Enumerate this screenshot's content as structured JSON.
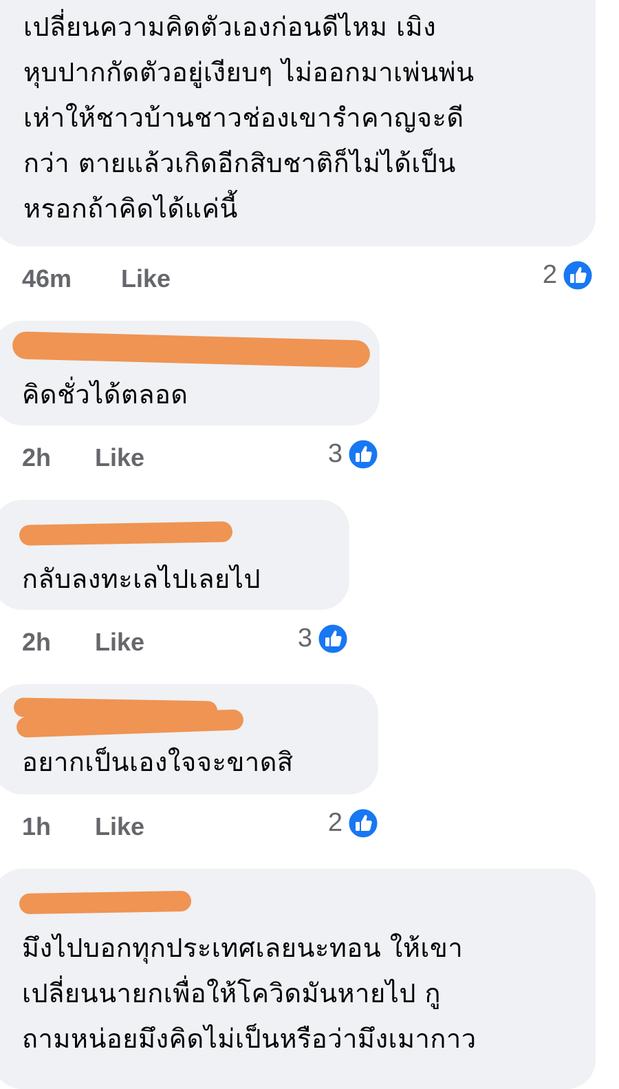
{
  "comments": [
    {
      "author": "",
      "text": "เปลี่ยนความคิดตัวเองก่อนดีไหม เมิง\nหุบปากกัดตัวอยู่เงียบๆ ไม่ออกมาเพ่นพ่น\nเห่าให้ชาวบ้านชาวช่องเขารำคาญจะดี\nกว่า ตายแล้วเกิดอีกสิบชาติก็ไม่ได้เป็น\nหรอกถ้าคิดได้แค่นี้",
      "time": "46m",
      "like_label": "Like",
      "reactions": "2"
    },
    {
      "author": "",
      "text": "คิดชั่วได้ตลอด",
      "time": "2h",
      "like_label": "Like",
      "reactions": "3"
    },
    {
      "author": "",
      "text": "กลับลงทะเลไปเลยไป",
      "time": "2h",
      "like_label": "Like",
      "reactions": "3"
    },
    {
      "author": "",
      "text": "อยากเป็นเองใจจะขาดสิ",
      "time": "1h",
      "like_label": "Like",
      "reactions": "2"
    },
    {
      "author": "",
      "text": "มึงไปบอกทุกประเทศเลยนะทอน ให้เขา\nเปลี่ยนนายกเพื่อให้โควิดมันหายไป กู\nถามหน่อยมึงคิดไม่เป็นหรือว่ามึงเมากาว",
      "time": "",
      "like_label": "",
      "reactions": ""
    }
  ],
  "colors": {
    "bubble": "#eff1f4",
    "meta_text": "#65676b",
    "like_icon": "#1877f2",
    "redaction": "#ef9453"
  },
  "icons": {
    "reaction": "like-reaction-icon"
  }
}
